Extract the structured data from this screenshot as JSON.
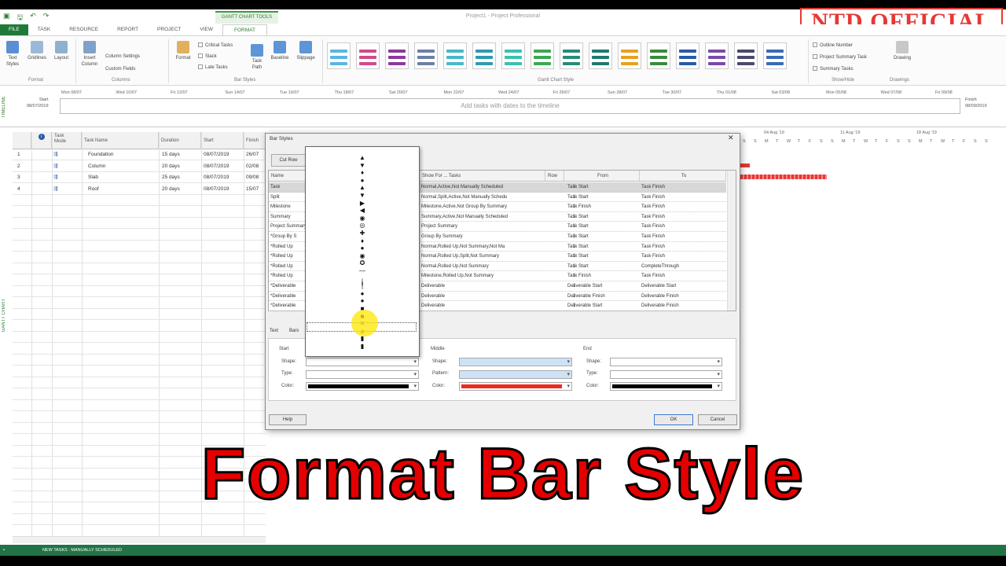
{
  "title_bar": {
    "app_title": "Project1 - Project Professional",
    "context_group": "GANTT CHART TOOLS"
  },
  "watermark": "NTD OFFICIAL",
  "tabs": [
    "FILE",
    "TASK",
    "RESOURCE",
    "REPORT",
    "PROJECT",
    "VIEW",
    "FORMAT"
  ],
  "ribbon": {
    "text_styles": "Text\nStyles",
    "gridlines": "Gridlines",
    "layout": "Layout",
    "insert_column": "Insert\nColumn",
    "column_settings": "Column Settings",
    "custom_fields": "Custom Fields",
    "format_btn": "Format",
    "critical_tasks": "Critical Tasks",
    "slack": "Slack",
    "late_tasks": "Late Tasks",
    "task_path": "Task\nPath",
    "baseline": "Baseline",
    "slippage": "Slippage",
    "outline_number": "Outline Number",
    "project_summary_task": "Project Summary Task",
    "summary_tasks": "Summary Tasks",
    "drawing": "Drawing",
    "groups": {
      "format": "Format",
      "columns": "Columns",
      "bar_styles": "Bar Styles",
      "gantt_chart_style": "Gantt Chart Style",
      "show_hide": "Show/Hide",
      "drawings": "Drawings"
    }
  },
  "timeline": {
    "side_label": "TIMELINE",
    "start_label": "Start",
    "start_date": "08/07/2019",
    "finish_label": "Finish",
    "finish_date": "08/09/2019",
    "message": "Add tasks with dates to the timeline",
    "dates": [
      "Mon 08/07",
      "Wed 10/07",
      "Fri 12/07",
      "Sun 14/07",
      "Tue 16/07",
      "Thu 18/07",
      "Sat 20/07",
      "Mon 22/07",
      "Wed 24/07",
      "Fri 26/07",
      "Sun 28/07",
      "Tue 30/07",
      "Thu 01/08",
      "Sat 03/08",
      "Mon 05/08",
      "Wed 07/08",
      "Fri 09/08"
    ]
  },
  "grid": {
    "side_label": "GANTT CHART",
    "headers": {
      "mode": "Task\nMode",
      "name": "Task Name",
      "duration": "Duration",
      "start": "Start",
      "finish": "Finish"
    },
    "rows": [
      {
        "id": "1",
        "name": "Foundation",
        "duration": "15 days",
        "start": "08/07/2019",
        "finish": "26/07"
      },
      {
        "id": "2",
        "name": "Column",
        "duration": "20 days",
        "start": "08/07/2019",
        "finish": "02/08"
      },
      {
        "id": "3",
        "name": "Slab",
        "duration": "25 days",
        "start": "08/07/2019",
        "finish": "09/08"
      },
      {
        "id": "4",
        "name": "Roof",
        "duration": "20 days",
        "start": "08/07/2019",
        "finish": "15/07"
      }
    ]
  },
  "chart": {
    "weeks": [
      "04 Aug '19",
      "11 Aug '19",
      "18 Aug '19"
    ],
    "days": [
      "S",
      "S",
      "M",
      "T",
      "W",
      "T",
      "F",
      "S",
      "S",
      "M",
      "T",
      "W",
      "T",
      "F",
      "S",
      "S",
      "M",
      "T",
      "W",
      "T",
      "F",
      "S",
      "S"
    ]
  },
  "dialog": {
    "title": "Bar Styles",
    "cut_row": "Cut Row",
    "columns": {
      "name": "Name",
      "show_for": "Show For ... Tasks",
      "row": "Row",
      "from": "From",
      "to": "To"
    },
    "rows": [
      {
        "name": "Task",
        "show_for": "Normal,Active,Not Manually Scheduled",
        "row": "1",
        "from": "Task Start",
        "to": "Task Finish"
      },
      {
        "name": "Split",
        "show_for": "Normal,Split,Active,Not Manually Schedu",
        "row": "1",
        "from": "Task Start",
        "to": "Task Finish"
      },
      {
        "name": "Milestone",
        "show_for": "Milestone,Active,Not Group By Summary",
        "row": "1",
        "from": "Task Finish",
        "to": "Task Finish"
      },
      {
        "name": "Summary",
        "show_for": "Summary,Active,Not Manually Scheduled",
        "row": "1",
        "from": "Task Start",
        "to": "Task Finish"
      },
      {
        "name": "Project Summary",
        "show_for": "Project Summary",
        "row": "1",
        "from": "Task Start",
        "to": "Task Finish"
      },
      {
        "name": "*Group By S",
        "show_for": "Group By Summary",
        "row": "1",
        "from": "Task Start",
        "to": "Task Finish"
      },
      {
        "name": "*Rolled Up",
        "show_for": "Normal,Rolled Up,Not Summary,Not Ma",
        "row": "1",
        "from": "Task Start",
        "to": "Task Finish"
      },
      {
        "name": "*Rolled Up",
        "show_for": "Normal,Rolled Up,Split,Not Summary",
        "row": "1",
        "from": "Task Start",
        "to": "Task Finish"
      },
      {
        "name": "*Rolled Up",
        "show_for": "Normal,Rolled Up,Not Summary",
        "row": "1",
        "from": "Task Start",
        "to": "CompleteThrough"
      },
      {
        "name": "*Rolled Up",
        "show_for": "Milestone,Rolled Up,Not Summary",
        "row": "1",
        "from": "Task Finish",
        "to": "Task Finish"
      },
      {
        "name": "*Deliverable",
        "show_for": "Deliverable",
        "row": "1",
        "from": "Deliverable Start",
        "to": "Deliverable Start"
      },
      {
        "name": "*Deliverable",
        "show_for": "Deliverable",
        "row": "1",
        "from": "Deliverable Finish",
        "to": "Deliverable Finish"
      },
      {
        "name": "*Deliverable",
        "show_for": "Deliverable",
        "row": "1",
        "from": "Deliverable Start",
        "to": "Deliverable Finish"
      }
    ],
    "tab_text": "Text",
    "tab_bars": "Bars",
    "start_group": "Start",
    "middle_group": "Middle",
    "end_group": "End",
    "shape_label": "Shape:",
    "type_label": "Type:",
    "pattern_label": "Pattern:",
    "color_label": "Color:",
    "colors": {
      "start": "#000000",
      "middle": "#ef2b1f",
      "end": "#000000"
    },
    "help": "Help",
    "ok": "OK",
    "cancel": "Cancel"
  },
  "shape_popup": [
    "▲",
    "▼",
    "♦",
    "●",
    "▲",
    "▼",
    "▶",
    "◀",
    "◉",
    "◎",
    "✚",
    "♦",
    "●",
    "◉",
    "✪",
    "—",
    "╷",
    "╿",
    "●",
    "●",
    "■",
    "■",
    "✕",
    "⌀",
    "▮",
    "▮"
  ],
  "caption": "Format Bar Style",
  "status": {
    "text": "NEW TASKS : MANUALLY SCHEDULED"
  }
}
